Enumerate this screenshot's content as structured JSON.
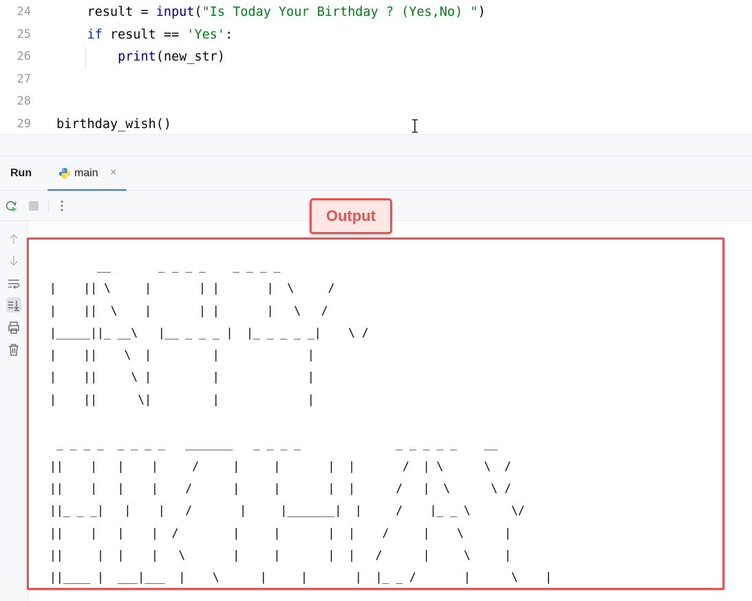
{
  "editor": {
    "lines": [
      {
        "num": "24",
        "parts": [
          {
            "t": "    result = ",
            "c": ""
          },
          {
            "t": "input",
            "c": "bi"
          },
          {
            "t": "(",
            "c": ""
          },
          {
            "t": "\"Is Today Your Birthday ? (Yes,No) \"",
            "c": "str"
          },
          {
            "t": ")",
            "c": ""
          }
        ]
      },
      {
        "num": "25",
        "parts": [
          {
            "t": "    ",
            "c": ""
          },
          {
            "t": "if",
            "c": "kw"
          },
          {
            "t": " result == ",
            "c": ""
          },
          {
            "t": "'Yes'",
            "c": "str"
          },
          {
            "t": ":",
            "c": ""
          }
        ]
      },
      {
        "num": "26",
        "parts": [
          {
            "t": "        ",
            "c": ""
          },
          {
            "t": "print",
            "c": "bi"
          },
          {
            "t": "(new_str)",
            "c": ""
          }
        ]
      },
      {
        "num": "27",
        "parts": []
      },
      {
        "num": "28",
        "parts": []
      },
      {
        "num": "29",
        "parts": [
          {
            "t": "birthday_wish()",
            "c": ""
          }
        ]
      }
    ]
  },
  "run_panel": {
    "label": "Run",
    "tab_label": "main",
    "tab_close": "×"
  },
  "console": {
    "previous_line": "  .          .           .",
    "ascii_art": "       __       _ _ _ _    _ _ _ _\n|    || \\     |       | |       |  \\     /\n|    ||  \\    |       | |       |   \\   /\n|_____||_ __\\   |__ _ _ _ |  |_ _ _ _ _|    \\ /\n|    ||    \\  |         |             |\n|    ||     \\ |         |             |\n|    ||      \\|         |             |\n\n _ _ _ _  _ _ _ _   _______   _ _ _ _              _ _ _ _ _    __\n||    |   |    |     /     |     |       |  |       /  | \\      \\  /\n||    |   |    |    /      |     |       |  |      /   |  \\      \\ /\n||_ _ _|   |    |   /       |     |_______|  |     /    |_ _ \\      \\/\n||    |   |    |  /        |     |       |  |    /     |    \\      |\n||     |  |    |   \\       |     |       |  |   /      |     \\     |\n||____ |  ___|___  |    \\      |     |       |  |_ _ /       |      \\    |"
  },
  "annotation": {
    "label": "Output"
  },
  "colors": {
    "annotation_red": "#e05555",
    "annotation_fill": "#ffe7e4",
    "tab_underline": "#3574f0",
    "string_green": "#067d17",
    "keyword_blue": "#0033b3"
  }
}
